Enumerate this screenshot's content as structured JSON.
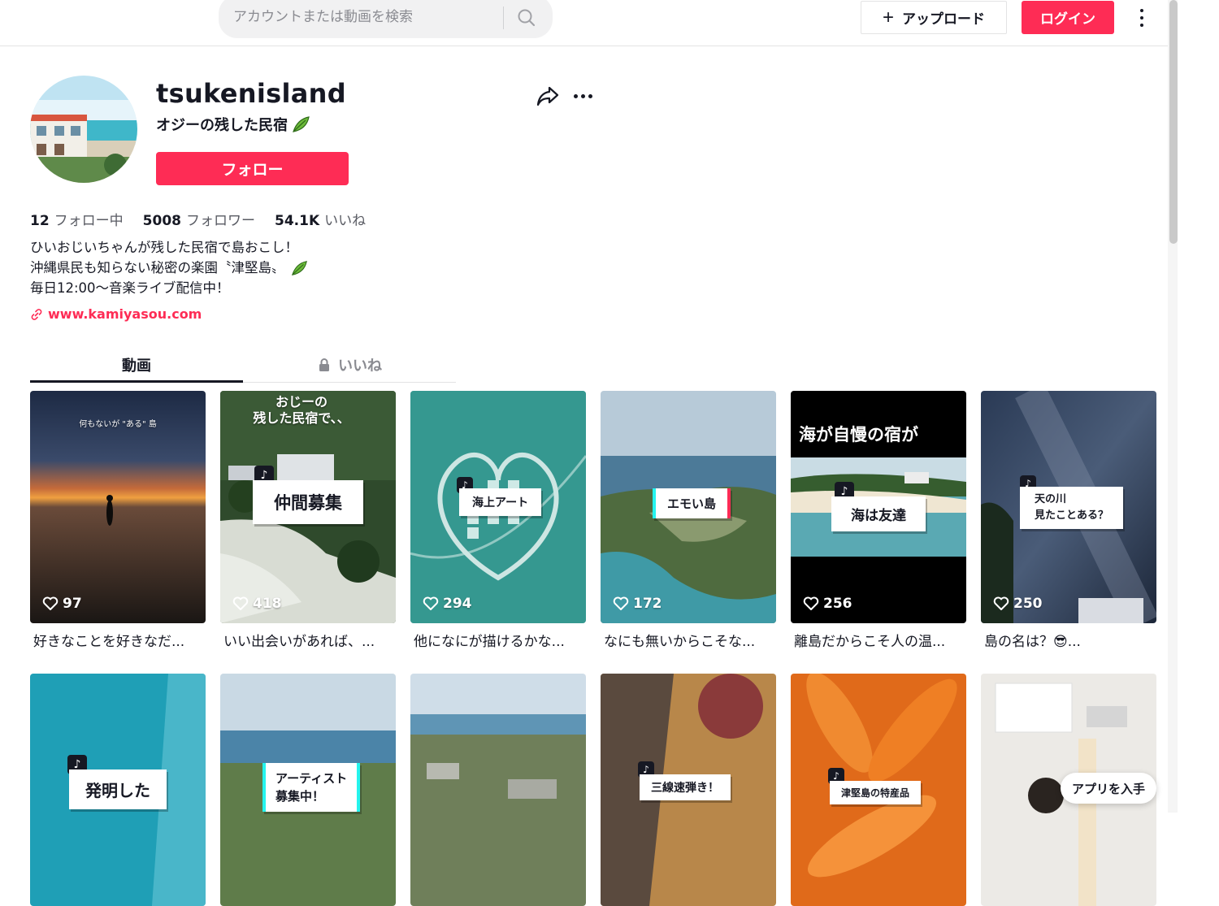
{
  "header": {
    "search_placeholder": "アカウントまたは動画を検索",
    "upload_label": "アップロード",
    "login_label": "ログイン"
  },
  "profile": {
    "username": "tsukenisland",
    "nickname": "オジーの残した民宿",
    "follow_label": "フォロー",
    "stats": {
      "following_count": "12",
      "following_label": "フォロー中",
      "followers_count": "5008",
      "followers_label": "フォロワー",
      "likes_count": "54.1K",
      "likes_label": "いいね"
    },
    "bio": [
      "ひいおじいちゃんが残した民宿で島おこし！",
      "沖縄県民も知らない秘密の楽園〝津堅島〟",
      "毎日12:00〜音楽ライブ配信中！"
    ],
    "link": "www.kamiyasou.com"
  },
  "tabs": {
    "videos": "動画",
    "liked": "いいね"
  },
  "videos": [
    {
      "likes": "97",
      "caption": "好きなことを好きなだ...",
      "overlay": "",
      "top_text": "何もないが \"ある\" 島"
    },
    {
      "likes": "418",
      "caption": "いい出会いがあれば、...",
      "overlay": "仲間募集",
      "top_text": "おじーの\n残した民宿で、、"
    },
    {
      "likes": "294",
      "caption": "他になにが描けるかな...",
      "overlay": "海上アート",
      "top_text": ""
    },
    {
      "likes": "172",
      "caption": "なにも無いからこそな...",
      "overlay": "エモい島",
      "top_text": ""
    },
    {
      "likes": "256",
      "caption": "離島だからこそ人の温...",
      "overlay": "海は友達",
      "top_text": "海が自慢の宿が"
    },
    {
      "likes": "250",
      "caption": "島の名は？😎...",
      "overlay": "天の川\n見たことある？",
      "top_text": ""
    },
    {
      "overlay": "発明した"
    },
    {
      "overlay": "アーティスト\n募集中！"
    },
    {
      "overlay": ""
    },
    {
      "overlay": "三線速弾き！"
    },
    {
      "overlay": "津堅島の特産品"
    },
    {
      "overlay": ""
    }
  ],
  "app_button": "アプリを入手",
  "colors": {
    "accent": "#fe2c55",
    "text": "#161823",
    "muted": "#8a8b91"
  }
}
